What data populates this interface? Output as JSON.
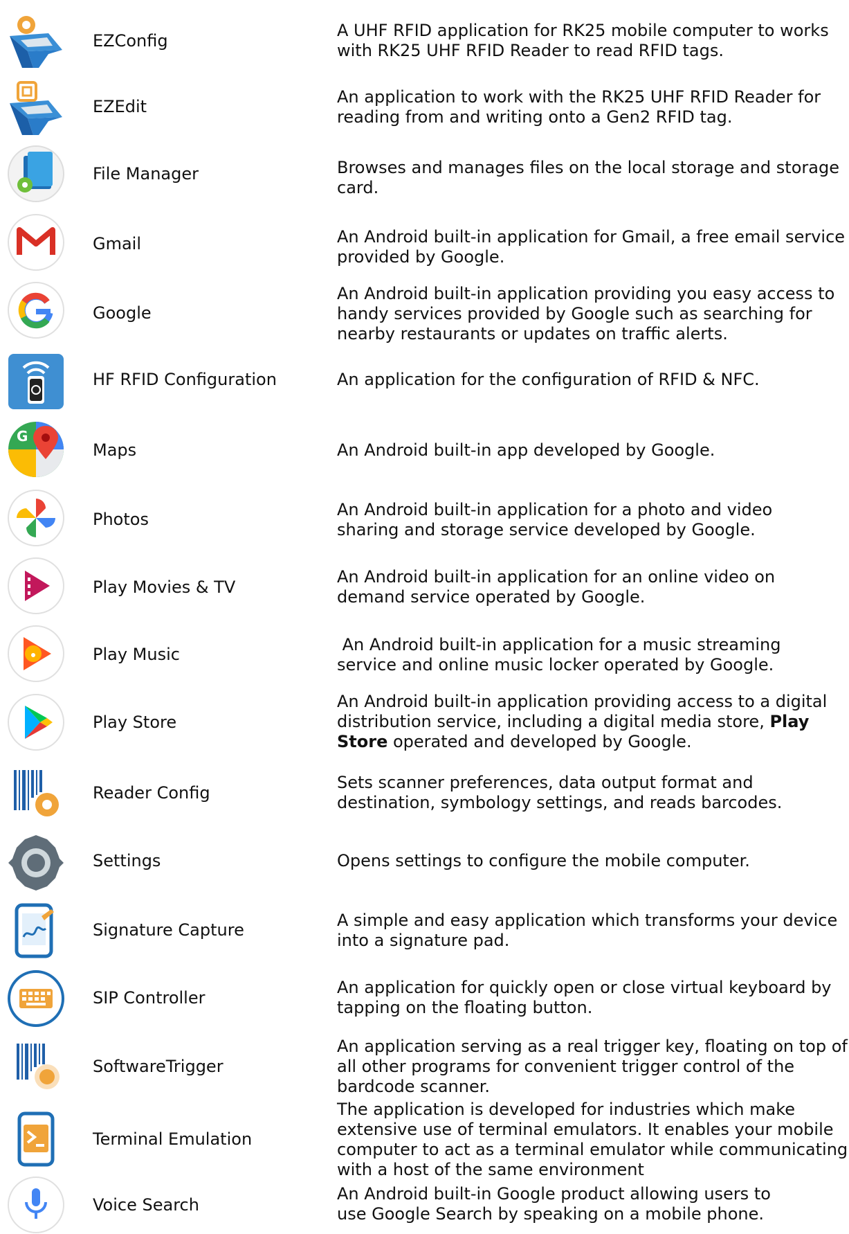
{
  "apps": [
    {
      "name": "EZConfig",
      "icon": "ezconfig-icon",
      "desc": [
        "A UHF RFID application for RK25 mobile computer to works",
        "with RK25 UHF RFID Reader to read RFID tags."
      ]
    },
    {
      "name": "EZEdit",
      "icon": "ezedit-icon",
      "desc": [
        "An application to work with the RK25 UHF RFID Reader for",
        "reading from and writing onto a Gen2 RFID tag."
      ]
    },
    {
      "name": "File Manager",
      "icon": "file-manager-icon",
      "desc": [
        "Browses and manages files on the local storage and storage",
        "card."
      ]
    },
    {
      "name": "Gmail",
      "icon": "gmail-icon",
      "desc": [
        "An Android built-in application for Gmail, a free email service",
        "provided by Google."
      ]
    },
    {
      "name": "Google",
      "icon": "google-icon",
      "desc": [
        "An Android built-in application providing you easy access to",
        "handy services provided by Google such as searching for",
        "nearby restaurants or updates on traffic alerts."
      ]
    },
    {
      "name": "HF RFID Configuration",
      "icon": "hf-rfid-icon",
      "desc": [
        "An application for the configuration of RFID & NFC."
      ]
    },
    {
      "name": "Maps",
      "icon": "maps-icon",
      "desc": [
        "An Android built-in app developed by Google."
      ]
    },
    {
      "name": "Photos",
      "icon": "photos-icon",
      "desc": [
        "An Android built-in application for a photo and video",
        "sharing and storage service developed by Google."
      ]
    },
    {
      "name": "Play Movies & TV",
      "icon": "play-movies-icon",
      "desc": [
        "An Android built-in application for an online video on",
        "demand service operated by Google."
      ]
    },
    {
      "name": "Play Music",
      "icon": "play-music-icon",
      "desc": [
        " An Android built-in application for a music streaming",
        "service and online music locker operated by Google."
      ]
    },
    {
      "name": "Play Store",
      "icon": "play-store-icon",
      "desc": [
        "An Android built-in application providing access to a digital",
        "distribution service, including a digital media store, ",
        "Play",
        "Store",
        " operated and developed by Google."
      ]
    },
    {
      "name": "Reader Config",
      "icon": "reader-config-icon",
      "desc": [
        "Sets scanner preferences, data output format and",
        "destination, symbology settings, and reads barcodes."
      ]
    },
    {
      "name": "Settings",
      "icon": "settings-icon",
      "desc": [
        "Opens settings to configure the mobile computer."
      ]
    },
    {
      "name": "Signature Capture",
      "icon": "signature-capture-icon",
      "desc": [
        "A simple and easy application which transforms your device",
        "into a signature pad."
      ]
    },
    {
      "name": "SIP Controller",
      "icon": "sip-controller-icon",
      "desc": [
        "An application for quickly open or close virtual keyboard by",
        "tapping on the floating button."
      ]
    },
    {
      "name": "SoftwareTrigger",
      "icon": "software-trigger-icon",
      "desc": [
        "An application serving as a real trigger key, floating on top of",
        "all other programs for convenient trigger control of the",
        "bardcode scanner."
      ]
    },
    {
      "name": "Terminal Emulation",
      "icon": "terminal-emulation-icon",
      "desc": [
        "The application is developed for industries which make",
        "extensive use of terminal emulators. It enables your mobile",
        "computer to act as a terminal emulator while communicating",
        "with a host of the same environment"
      ]
    },
    {
      "name": "Voice Search",
      "icon": "voice-search-icon",
      "desc": [
        "An Android built-in Google product allowing users to",
        "use Google Search by speaking on a mobile phone."
      ]
    }
  ]
}
